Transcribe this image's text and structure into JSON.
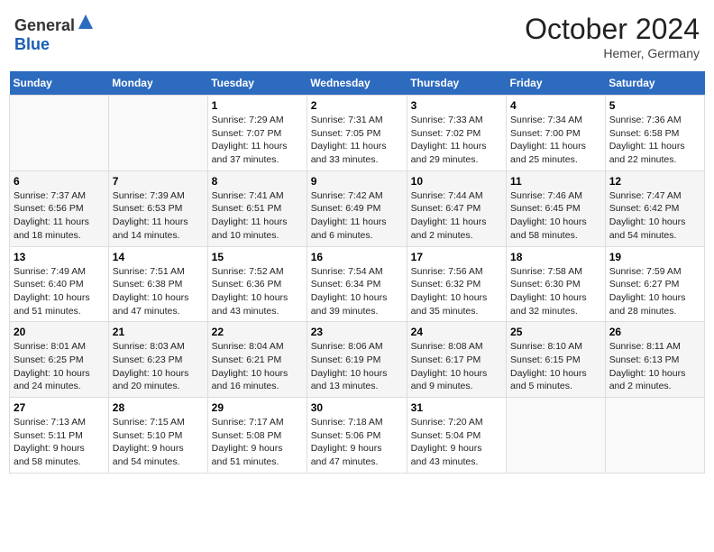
{
  "header": {
    "logo_general": "General",
    "logo_blue": "Blue",
    "title": "October 2024",
    "subtitle": "Hemer, Germany"
  },
  "calendar": {
    "days_of_week": [
      "Sunday",
      "Monday",
      "Tuesday",
      "Wednesday",
      "Thursday",
      "Friday",
      "Saturday"
    ],
    "weeks": [
      [
        {
          "day": "",
          "info": ""
        },
        {
          "day": "",
          "info": ""
        },
        {
          "day": "1",
          "info": "Sunrise: 7:29 AM\nSunset: 7:07 PM\nDaylight: 11 hours\nand 37 minutes."
        },
        {
          "day": "2",
          "info": "Sunrise: 7:31 AM\nSunset: 7:05 PM\nDaylight: 11 hours\nand 33 minutes."
        },
        {
          "day": "3",
          "info": "Sunrise: 7:33 AM\nSunset: 7:02 PM\nDaylight: 11 hours\nand 29 minutes."
        },
        {
          "day": "4",
          "info": "Sunrise: 7:34 AM\nSunset: 7:00 PM\nDaylight: 11 hours\nand 25 minutes."
        },
        {
          "day": "5",
          "info": "Sunrise: 7:36 AM\nSunset: 6:58 PM\nDaylight: 11 hours\nand 22 minutes."
        }
      ],
      [
        {
          "day": "6",
          "info": "Sunrise: 7:37 AM\nSunset: 6:56 PM\nDaylight: 11 hours\nand 18 minutes."
        },
        {
          "day": "7",
          "info": "Sunrise: 7:39 AM\nSunset: 6:53 PM\nDaylight: 11 hours\nand 14 minutes."
        },
        {
          "day": "8",
          "info": "Sunrise: 7:41 AM\nSunset: 6:51 PM\nDaylight: 11 hours\nand 10 minutes."
        },
        {
          "day": "9",
          "info": "Sunrise: 7:42 AM\nSunset: 6:49 PM\nDaylight: 11 hours\nand 6 minutes."
        },
        {
          "day": "10",
          "info": "Sunrise: 7:44 AM\nSunset: 6:47 PM\nDaylight: 11 hours\nand 2 minutes."
        },
        {
          "day": "11",
          "info": "Sunrise: 7:46 AM\nSunset: 6:45 PM\nDaylight: 10 hours\nand 58 minutes."
        },
        {
          "day": "12",
          "info": "Sunrise: 7:47 AM\nSunset: 6:42 PM\nDaylight: 10 hours\nand 54 minutes."
        }
      ],
      [
        {
          "day": "13",
          "info": "Sunrise: 7:49 AM\nSunset: 6:40 PM\nDaylight: 10 hours\nand 51 minutes."
        },
        {
          "day": "14",
          "info": "Sunrise: 7:51 AM\nSunset: 6:38 PM\nDaylight: 10 hours\nand 47 minutes."
        },
        {
          "day": "15",
          "info": "Sunrise: 7:52 AM\nSunset: 6:36 PM\nDaylight: 10 hours\nand 43 minutes."
        },
        {
          "day": "16",
          "info": "Sunrise: 7:54 AM\nSunset: 6:34 PM\nDaylight: 10 hours\nand 39 minutes."
        },
        {
          "day": "17",
          "info": "Sunrise: 7:56 AM\nSunset: 6:32 PM\nDaylight: 10 hours\nand 35 minutes."
        },
        {
          "day": "18",
          "info": "Sunrise: 7:58 AM\nSunset: 6:30 PM\nDaylight: 10 hours\nand 32 minutes."
        },
        {
          "day": "19",
          "info": "Sunrise: 7:59 AM\nSunset: 6:27 PM\nDaylight: 10 hours\nand 28 minutes."
        }
      ],
      [
        {
          "day": "20",
          "info": "Sunrise: 8:01 AM\nSunset: 6:25 PM\nDaylight: 10 hours\nand 24 minutes."
        },
        {
          "day": "21",
          "info": "Sunrise: 8:03 AM\nSunset: 6:23 PM\nDaylight: 10 hours\nand 20 minutes."
        },
        {
          "day": "22",
          "info": "Sunrise: 8:04 AM\nSunset: 6:21 PM\nDaylight: 10 hours\nand 16 minutes."
        },
        {
          "day": "23",
          "info": "Sunrise: 8:06 AM\nSunset: 6:19 PM\nDaylight: 10 hours\nand 13 minutes."
        },
        {
          "day": "24",
          "info": "Sunrise: 8:08 AM\nSunset: 6:17 PM\nDaylight: 10 hours\nand 9 minutes."
        },
        {
          "day": "25",
          "info": "Sunrise: 8:10 AM\nSunset: 6:15 PM\nDaylight: 10 hours\nand 5 minutes."
        },
        {
          "day": "26",
          "info": "Sunrise: 8:11 AM\nSunset: 6:13 PM\nDaylight: 10 hours\nand 2 minutes."
        }
      ],
      [
        {
          "day": "27",
          "info": "Sunrise: 7:13 AM\nSunset: 5:11 PM\nDaylight: 9 hours\nand 58 minutes."
        },
        {
          "day": "28",
          "info": "Sunrise: 7:15 AM\nSunset: 5:10 PM\nDaylight: 9 hours\nand 54 minutes."
        },
        {
          "day": "29",
          "info": "Sunrise: 7:17 AM\nSunset: 5:08 PM\nDaylight: 9 hours\nand 51 minutes."
        },
        {
          "day": "30",
          "info": "Sunrise: 7:18 AM\nSunset: 5:06 PM\nDaylight: 9 hours\nand 47 minutes."
        },
        {
          "day": "31",
          "info": "Sunrise: 7:20 AM\nSunset: 5:04 PM\nDaylight: 9 hours\nand 43 minutes."
        },
        {
          "day": "",
          "info": ""
        },
        {
          "day": "",
          "info": ""
        }
      ]
    ]
  }
}
